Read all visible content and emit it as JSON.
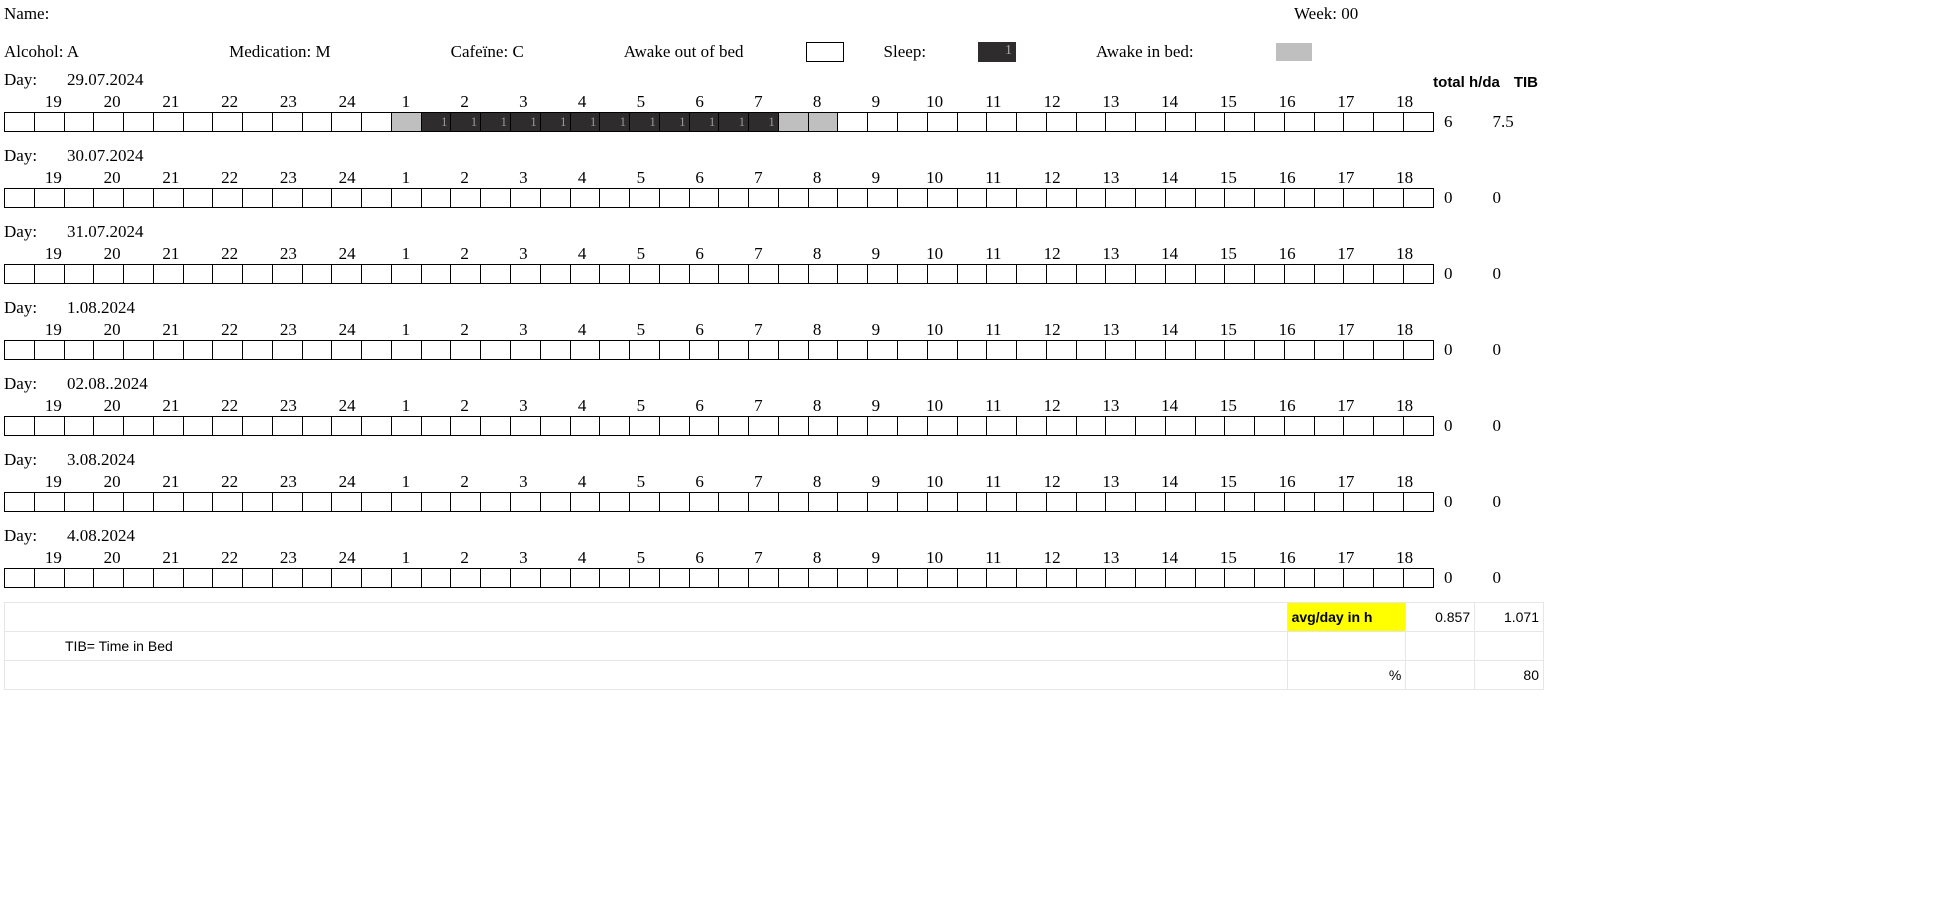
{
  "header": {
    "name_label": "Name:",
    "week_label": "Week:",
    "week_value": "00"
  },
  "legend": {
    "alcohol": "Alcohol: A",
    "medication": "Medication: M",
    "cafeine": "Cafeïne: C",
    "awake_out": "Awake out of bed",
    "sleep": "Sleep:",
    "awake_in": "Awake in bed:"
  },
  "totals_header": {
    "hday": "total h/da",
    "tib": "TIB"
  },
  "hours": [
    "19",
    "20",
    "21",
    "22",
    "23",
    "24",
    "1",
    "2",
    "3",
    "4",
    "5",
    "6",
    "7",
    "8",
    "9",
    "10",
    "11",
    "12",
    "13",
    "14",
    "15",
    "16",
    "17",
    "18"
  ],
  "day_label": "Day:",
  "days": [
    {
      "date": "29.07.2024",
      "cells": [
        "",
        "",
        "",
        "",
        "",
        "",
        "",
        "",
        "",
        "",
        "",
        "",
        "",
        "awakebed",
        "sleep",
        "sleep",
        "sleep",
        "sleep",
        "sleep",
        "sleep",
        "sleep",
        "sleep",
        "sleep",
        "sleep",
        "sleep",
        "sleep",
        "awakebed",
        "awakebed",
        "",
        "",
        "",
        "",
        "",
        "",
        "",
        "",
        "",
        "",
        "",
        "",
        "",
        "",
        "",
        "",
        "",
        "",
        "",
        ""
      ],
      "total_h": "6",
      "tib": "7.5"
    },
    {
      "date": "30.07.2024",
      "cells": [
        "",
        "",
        "",
        "",
        "",
        "",
        "",
        "",
        "",
        "",
        "",
        "",
        "",
        "",
        "",
        "",
        "",
        "",
        "",
        "",
        "",
        "",
        "",
        "",
        "",
        "",
        "",
        "",
        "",
        "",
        "",
        "",
        "",
        "",
        "",
        "",
        "",
        "",
        "",
        "",
        "",
        "",
        "",
        "",
        "",
        "",
        "",
        ""
      ],
      "total_h": "0",
      "tib": "0"
    },
    {
      "date": "31.07.2024",
      "cells": [
        "",
        "",
        "",
        "",
        "",
        "",
        "",
        "",
        "",
        "",
        "",
        "",
        "",
        "",
        "",
        "",
        "",
        "",
        "",
        "",
        "",
        "",
        "",
        "",
        "",
        "",
        "",
        "",
        "",
        "",
        "",
        "",
        "",
        "",
        "",
        "",
        "",
        "",
        "",
        "",
        "",
        "",
        "",
        "",
        "",
        "",
        "",
        ""
      ],
      "total_h": "0",
      "tib": "0"
    },
    {
      "date": "1.08.2024",
      "cells": [
        "",
        "",
        "",
        "",
        "",
        "",
        "",
        "",
        "",
        "",
        "",
        "",
        "",
        "",
        "",
        "",
        "",
        "",
        "",
        "",
        "",
        "",
        "",
        "",
        "",
        "",
        "",
        "",
        "",
        "",
        "",
        "",
        "",
        "",
        "",
        "",
        "",
        "",
        "",
        "",
        "",
        "",
        "",
        "",
        "",
        "",
        "",
        ""
      ],
      "total_h": "0",
      "tib": "0"
    },
    {
      "date": "02.08..2024",
      "cells": [
        "",
        "",
        "",
        "",
        "",
        "",
        "",
        "",
        "",
        "",
        "",
        "",
        "",
        "",
        "",
        "",
        "",
        "",
        "",
        "",
        "",
        "",
        "",
        "",
        "",
        "",
        "",
        "",
        "",
        "",
        "",
        "",
        "",
        "",
        "",
        "",
        "",
        "",
        "",
        "",
        "",
        "",
        "",
        "",
        "",
        "",
        "",
        ""
      ],
      "total_h": "0",
      "tib": "0"
    },
    {
      "date": "3.08.2024",
      "cells": [
        "",
        "",
        "",
        "",
        "",
        "",
        "",
        "",
        "",
        "",
        "",
        "",
        "",
        "",
        "",
        "",
        "",
        "",
        "",
        "",
        "",
        "",
        "",
        "",
        "",
        "",
        "",
        "",
        "",
        "",
        "",
        "",
        "",
        "",
        "",
        "",
        "",
        "",
        "",
        "",
        "",
        "",
        "",
        "",
        "",
        "",
        "",
        ""
      ],
      "total_h": "0",
      "tib": "0"
    },
    {
      "date": "4.08.2024",
      "cells": [
        "",
        "",
        "",
        "",
        "",
        "",
        "",
        "",
        "",
        "",
        "",
        "",
        "",
        "",
        "",
        "",
        "",
        "",
        "",
        "",
        "",
        "",
        "",
        "",
        "",
        "",
        "",
        "",
        "",
        "",
        "",
        "",
        "",
        "",
        "",
        "",
        "",
        "",
        "",
        "",
        "",
        "",
        "",
        "",
        "",
        "",
        "",
        ""
      ],
      "total_h": "0",
      "tib": "0"
    }
  ],
  "footer": {
    "avg_label": "avg/day in h",
    "avg_h": "0.857",
    "avg_tib": "1.071",
    "tib_note": "TIB= Time in Bed",
    "pct_label": "%",
    "pct_value": "80"
  }
}
